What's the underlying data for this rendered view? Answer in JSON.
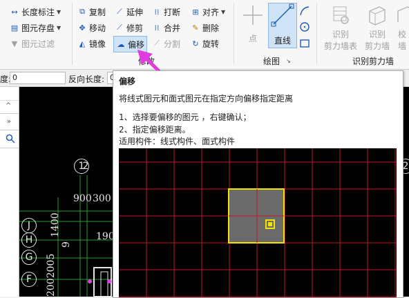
{
  "ribbon": {
    "col1": {
      "length_label": "长度标注",
      "save_label": "图元存盘",
      "filter_label": "图元过滤"
    },
    "modify": {
      "copy": "复制",
      "move": "移动",
      "mirror": "镜像",
      "extend": "延伸",
      "trim": "修剪",
      "offset": "偏移",
      "break": "打断",
      "merge": "合并",
      "split": "分割",
      "align": "对齐",
      "delete": "删除",
      "rotate": "旋转",
      "group_label": "修改"
    },
    "draw": {
      "point": "点",
      "line": "直线",
      "group_label": "绘图"
    },
    "shear_wall": {
      "btn1": "识别",
      "btn1_sub": "剪力墙表",
      "btn2": "识别",
      "btn2_sub": "剪力墙",
      "btn3": "校",
      "btn3_sub": "墙",
      "group_label": "识别剪力墙"
    }
  },
  "propbar": {
    "label1": "度:",
    "value1": "0",
    "label2": "反向长度:",
    "value2": "0"
  },
  "leftpanel": {
    "scroll_up": "^",
    "expand": "»",
    "search_icon": "search-icon"
  },
  "canvas": {
    "axes_top": [
      "1",
      "2",
      "2"
    ],
    "axes_left": [
      "J",
      "H",
      "G",
      "F"
    ],
    "dims": [
      "900",
      "300",
      "190",
      "1400",
      "9",
      "2002005",
      "2"
    ]
  },
  "tooltip": {
    "title": "偏移",
    "description": "将线式图元和面式图元在指定方向偏移指定距离",
    "step1": "1、选择要偏移的图元 ，右键确认；",
    "step2": "2、指定偏移距离。",
    "applicable": "适用构件：线式构件、面式构件"
  },
  "colors": {
    "accent_pink": "#e23be0",
    "grid_red": "#c8102e",
    "selection_yellow": "#f2e600",
    "ribbon_blue": "#1e5bb8"
  }
}
